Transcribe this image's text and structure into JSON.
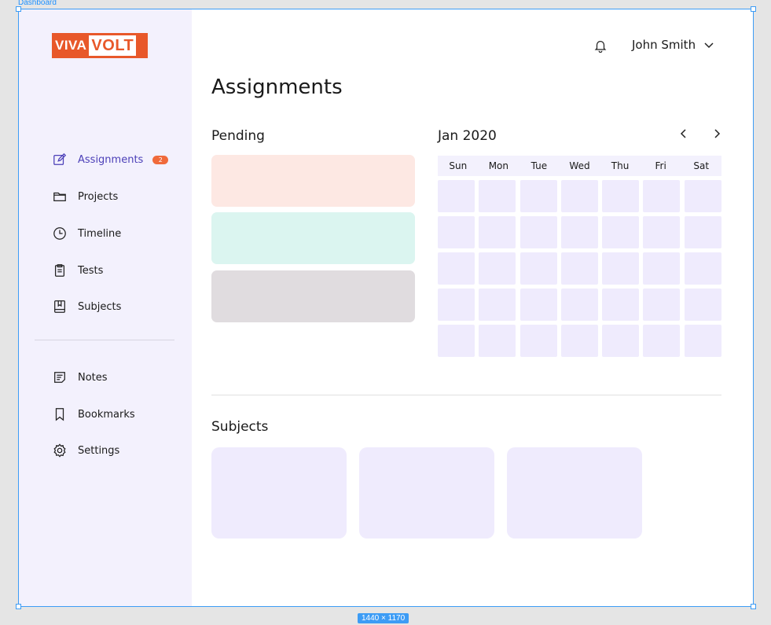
{
  "canvas": {
    "frame_label": "Dashboard",
    "size_badge": "1440 × 1170"
  },
  "brand": {
    "logo_part1": "VIVA",
    "logo_part2": "VOLT",
    "color": "#e8582a"
  },
  "sidebar": {
    "items": [
      {
        "label": "Assignments",
        "icon": "pencil-square-icon",
        "active": true,
        "badge": "2"
      },
      {
        "label": "Projects",
        "icon": "folder-icon"
      },
      {
        "label": "Timeline",
        "icon": "clock-icon"
      },
      {
        "label": "Tests",
        "icon": "clipboard-icon"
      },
      {
        "label": "Subjects",
        "icon": "book-icon"
      },
      {
        "label": "Notes",
        "icon": "notes-icon"
      },
      {
        "label": "Bookmarks",
        "icon": "bookmark-icon"
      },
      {
        "label": "Settings",
        "icon": "gear-icon"
      }
    ]
  },
  "header": {
    "user_name": "John Smith",
    "bell_icon": "bell-icon",
    "chevron_icon": "chevron-down-icon"
  },
  "main": {
    "title": "Assignments",
    "pending": {
      "title": "Pending",
      "cards": [
        {
          "color": "#fde8e3"
        },
        {
          "color": "#dbf5f0"
        },
        {
          "color": "#e0dcdf"
        }
      ]
    },
    "calendar": {
      "title": "Jan 2020",
      "days": [
        "Sun",
        "Mon",
        "Tue",
        "Wed",
        "Thu",
        "Fri",
        "Sat"
      ]
    },
    "subjects": {
      "title": "Subjects"
    }
  }
}
